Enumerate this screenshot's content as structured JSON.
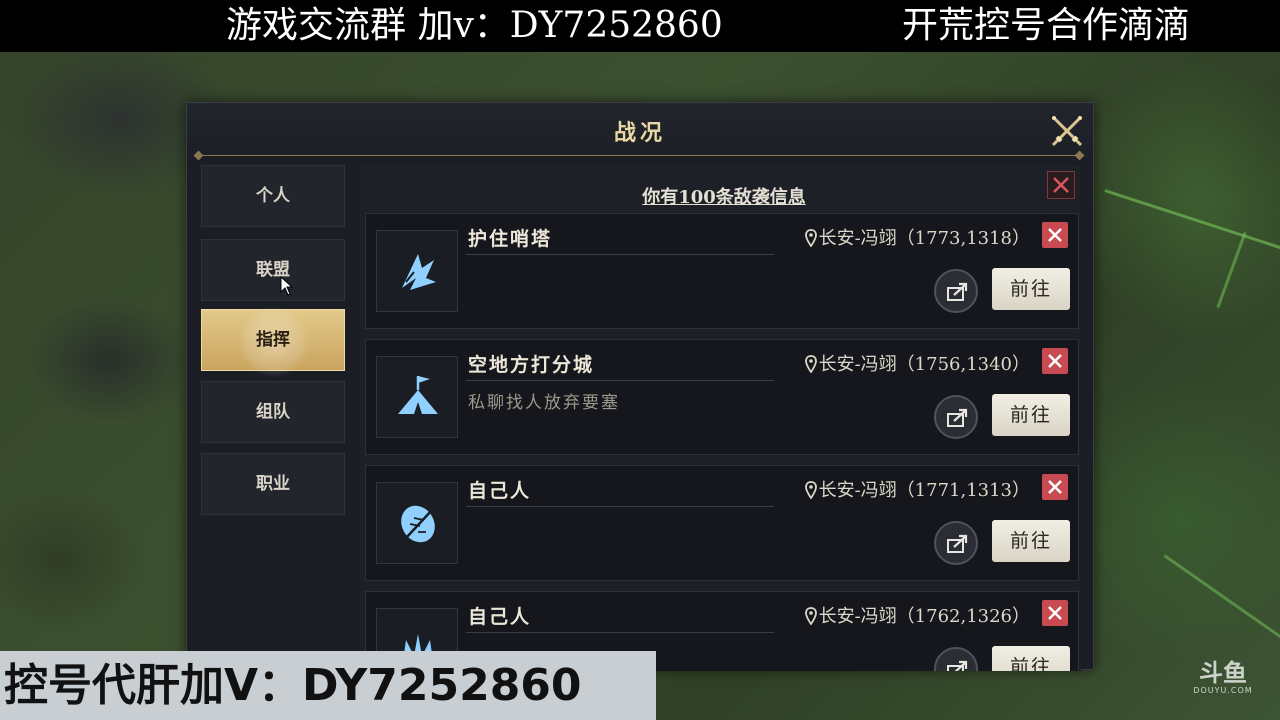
{
  "overlay": {
    "top_left_ad": "游戏交流群 加v：DY7252860",
    "top_right_ad": "开荒控号合作滴滴",
    "bottom_ad": "控号代肝加V：DY7252860",
    "watermark_glyph": "斗鱼",
    "watermark_text": "DOUYU.COM"
  },
  "dialog": {
    "title": "战况",
    "close_icon": "crossed-swords-icon"
  },
  "sidebar": {
    "items": [
      {
        "label": "个人"
      },
      {
        "label": "联盟"
      },
      {
        "label": "指挥",
        "active": true
      },
      {
        "label": "组队"
      },
      {
        "label": "职业"
      }
    ]
  },
  "summary": {
    "text": "你有100条敌袭信息"
  },
  "reports": [
    {
      "title": "护住哨塔",
      "desc": "",
      "location": "长安-冯翊（1773,1318）",
      "icon": "shattered-tower-icon",
      "go_label": "前往"
    },
    {
      "title": "空地方打分城",
      "desc": "私聊找人放弃要塞",
      "location": "长安-冯翊（1756,1340）",
      "icon": "tent-flag-icon",
      "go_label": "前往"
    },
    {
      "title": "自己人",
      "desc": "",
      "location": "长安-冯翊（1771,1313）",
      "icon": "leaf-shield-icon",
      "go_label": "前往"
    },
    {
      "title": "自己人",
      "desc": "",
      "location": "长安-冯翊（1762,1326）",
      "icon": "flame-icon",
      "go_label": "前往"
    }
  ],
  "colors": {
    "accent_gold": "#e3c98a",
    "remove_red": "#c84b52",
    "icon_blue": "#8fd0ff"
  }
}
